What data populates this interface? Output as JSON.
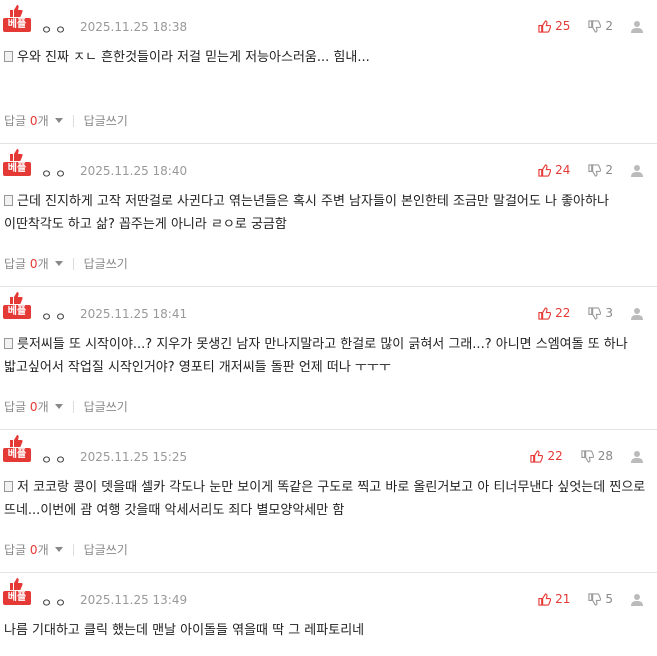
{
  "best_label": "베플",
  "reply_label": "답글",
  "reply_suffix": "개",
  "write_reply_label": "답글쓰기",
  "accent_color": "#e53935",
  "comments": [
    {
      "nick": "ㅇㅇ",
      "date": "2025.11.25 18:38",
      "up": "25",
      "down": "2",
      "text": "우와 진짜 ㅈㄴ 흔한것들이라 저걸 믿는게 저능아스러움... 힘내...",
      "replies": "0"
    },
    {
      "nick": "ㅇㅇ",
      "date": "2025.11.25 18:40",
      "up": "24",
      "down": "2",
      "text": "근데 진지하게 고작 저딴걸로 사귄다고 엮는년들은 혹시 주변 남자들이 본인한테 조금만 말걸어도 나 좋아하나 이딴착각도 하고 삶? 꼽주는게 아니라 ㄹㅇ로 궁금함",
      "replies": "0"
    },
    {
      "nick": "ㅇㅇ",
      "date": "2025.11.25 18:41",
      "up": "22",
      "down": "3",
      "text": "릇저씨들 또 시작이야...? 지우가 못생긴 남자 만나지말라고 한걸로 많이 긁혀서 그래...? 아니면 스엠여돌 또 하나 밟고싶어서 작업질 시작인거야? 영포티 개저씨들 돌판 언제 떠나 ㅜㅜㅜ",
      "replies": "0"
    },
    {
      "nick": "ㅇㅇ",
      "date": "2025.11.25 15:25",
      "up": "22",
      "down": "28",
      "text": "저 코코랑 콩이 뎃을때 셀카 각도나 눈만 보이게 똑같은 구도로 찍고 바로 올린거보고 아 티너무낸다 싶엇는데 찐으로 뜨네...이번에 괌 여행 갓을때 악세서리도 죄다 별모양악세만 함",
      "replies": "0"
    },
    {
      "nick": "ㅇㅇ",
      "date": "2025.11.25 13:49",
      "up": "21",
      "down": "5",
      "text": "나름 기대하고 클릭 했는데 맨날 아이돌들 엮을때 딱 그 레파토리네",
      "replies": ""
    }
  ]
}
